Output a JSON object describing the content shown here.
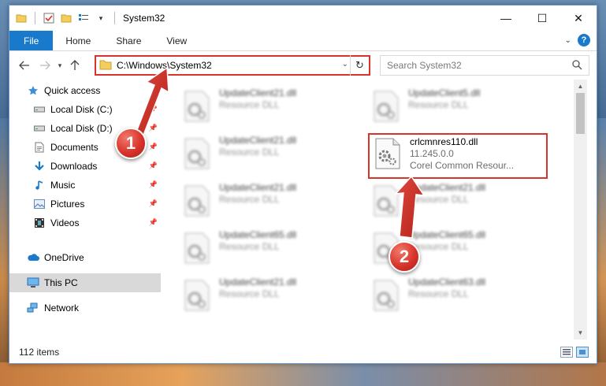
{
  "window": {
    "title": "System32",
    "minimize": "—",
    "maximize": "☐",
    "close": "✕"
  },
  "ribbon": {
    "tabs": [
      "File",
      "Home",
      "Share",
      "View"
    ],
    "help": "?"
  },
  "nav": {
    "address_path": "C:\\Windows\\System32",
    "search_placeholder": "Search System32"
  },
  "sidebar": {
    "items": [
      {
        "label": "Quick access",
        "icon": "star-icon",
        "pinned": false
      },
      {
        "label": "Local Disk (C:)",
        "icon": "drive-icon",
        "pinned": true
      },
      {
        "label": "Local Disk (D:)",
        "icon": "drive-icon",
        "pinned": true
      },
      {
        "label": "Documents",
        "icon": "documents-icon",
        "pinned": true
      },
      {
        "label": "Downloads",
        "icon": "downloads-icon",
        "pinned": true
      },
      {
        "label": "Music",
        "icon": "music-icon",
        "pinned": true
      },
      {
        "label": "Pictures",
        "icon": "pictures-icon",
        "pinned": true
      },
      {
        "label": "Videos",
        "icon": "videos-icon",
        "pinned": true
      },
      {
        "label": "OneDrive",
        "icon": "cloud-icon",
        "pinned": false
      },
      {
        "label": "This PC",
        "icon": "computer-icon",
        "pinned": false,
        "selected": true
      },
      {
        "label": "Network",
        "icon": "network-icon",
        "pinned": false
      }
    ]
  },
  "files": {
    "left_column": [
      {
        "name": "UpdateClient21.dll",
        "sub": "Resource DLL"
      },
      {
        "name": "UpdateClient21.dll",
        "sub": "Resource DLL"
      },
      {
        "name": "UpdateClient21.dll",
        "sub": "Resource DLL"
      },
      {
        "name": "UpdateClient65.dll",
        "sub": "Resource DLL"
      },
      {
        "name": "UpdateClient21.dll",
        "sub": "Resource DLL"
      }
    ],
    "right_column": [
      {
        "name": "UpdateClient5.dll",
        "sub": "Resource DLL"
      },
      {
        "name": "crlcmnres110.dll",
        "version": "11.245.0.0",
        "description": "Corel Common Resour...",
        "highlighted": true
      },
      {
        "name": "UpdateClient21.dll",
        "sub": "Resource DLL"
      },
      {
        "name": "UpdateClient65.dll",
        "sub": "Resource DLL"
      },
      {
        "name": "UpdateClient63.dll",
        "sub": "Resource DLL"
      }
    ]
  },
  "status": {
    "item_count": "112 items"
  },
  "annotations": {
    "step1": "1",
    "step2": "2",
    "color": "#d9342b"
  }
}
